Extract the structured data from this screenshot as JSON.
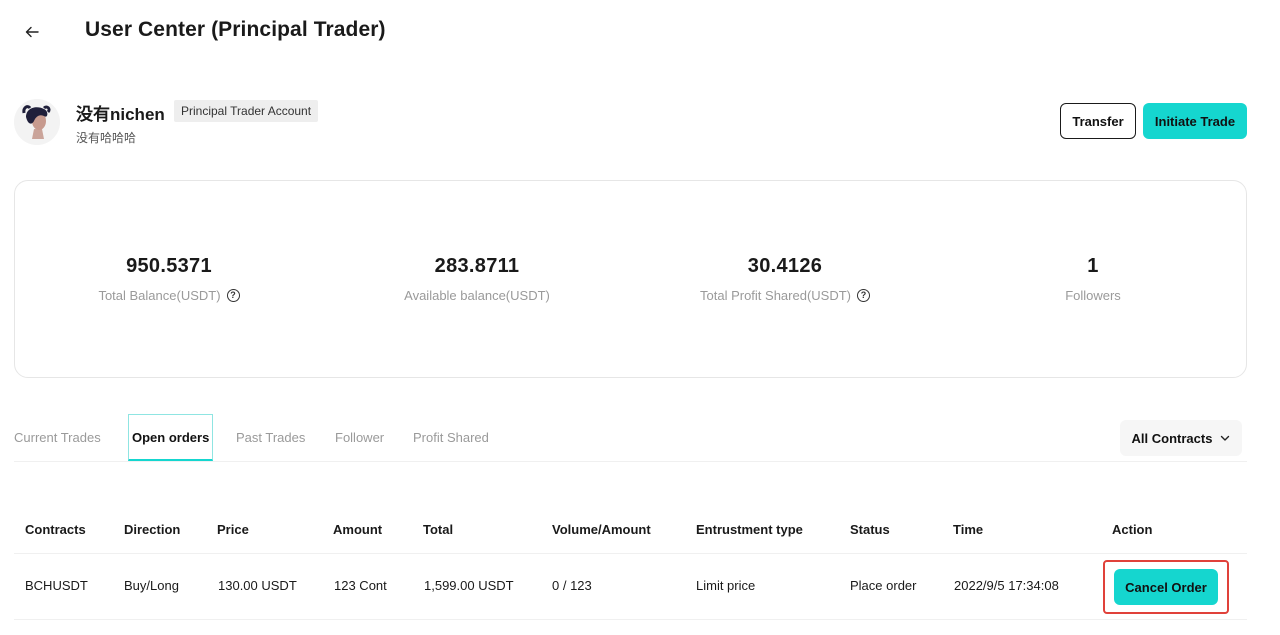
{
  "header": {
    "title": "User Center (Principal Trader)"
  },
  "profile": {
    "username": "没有nichen",
    "account_badge": "Principal Trader Account",
    "subtitle": "没有哈哈哈"
  },
  "actions": {
    "transfer_label": "Transfer",
    "initiate_label": "Initiate Trade"
  },
  "stats": [
    {
      "value": "950.5371",
      "label": "Total Balance(USDT)",
      "has_help": true
    },
    {
      "value": "283.8711",
      "label": "Available balance(USDT)",
      "has_help": false
    },
    {
      "value": "30.4126",
      "label": "Total Profit Shared(USDT)",
      "has_help": true
    },
    {
      "value": "1",
      "label": "Followers",
      "has_help": false
    }
  ],
  "tabs": [
    {
      "label": "Current Trades",
      "active": false
    },
    {
      "label": "Open orders",
      "active": true
    },
    {
      "label": "Past Trades",
      "active": false
    },
    {
      "label": "Follower",
      "active": false
    },
    {
      "label": "Profit Shared",
      "active": false
    }
  ],
  "filter": {
    "selected": "All Contracts"
  },
  "table": {
    "headers": [
      "Contracts",
      "Direction",
      "Price",
      "Amount",
      "Total",
      "Volume/Amount",
      "Entrustment type",
      "Status",
      "Time",
      "Action"
    ],
    "rows": [
      {
        "contracts": "BCHUSDT",
        "direction": "Buy/Long",
        "price": "130.00 USDT",
        "amount": "123 Cont",
        "total": "1,599.00 USDT",
        "volume_amount": "0 / 123",
        "entrustment_type": "Limit price",
        "status": "Place order",
        "time": "2022/9/5 17:34:08",
        "action_label": "Cancel Order"
      }
    ]
  },
  "colors": {
    "accent": "#15d6cf",
    "highlight_border": "#e0413a",
    "muted_text": "#9a9a9a"
  }
}
